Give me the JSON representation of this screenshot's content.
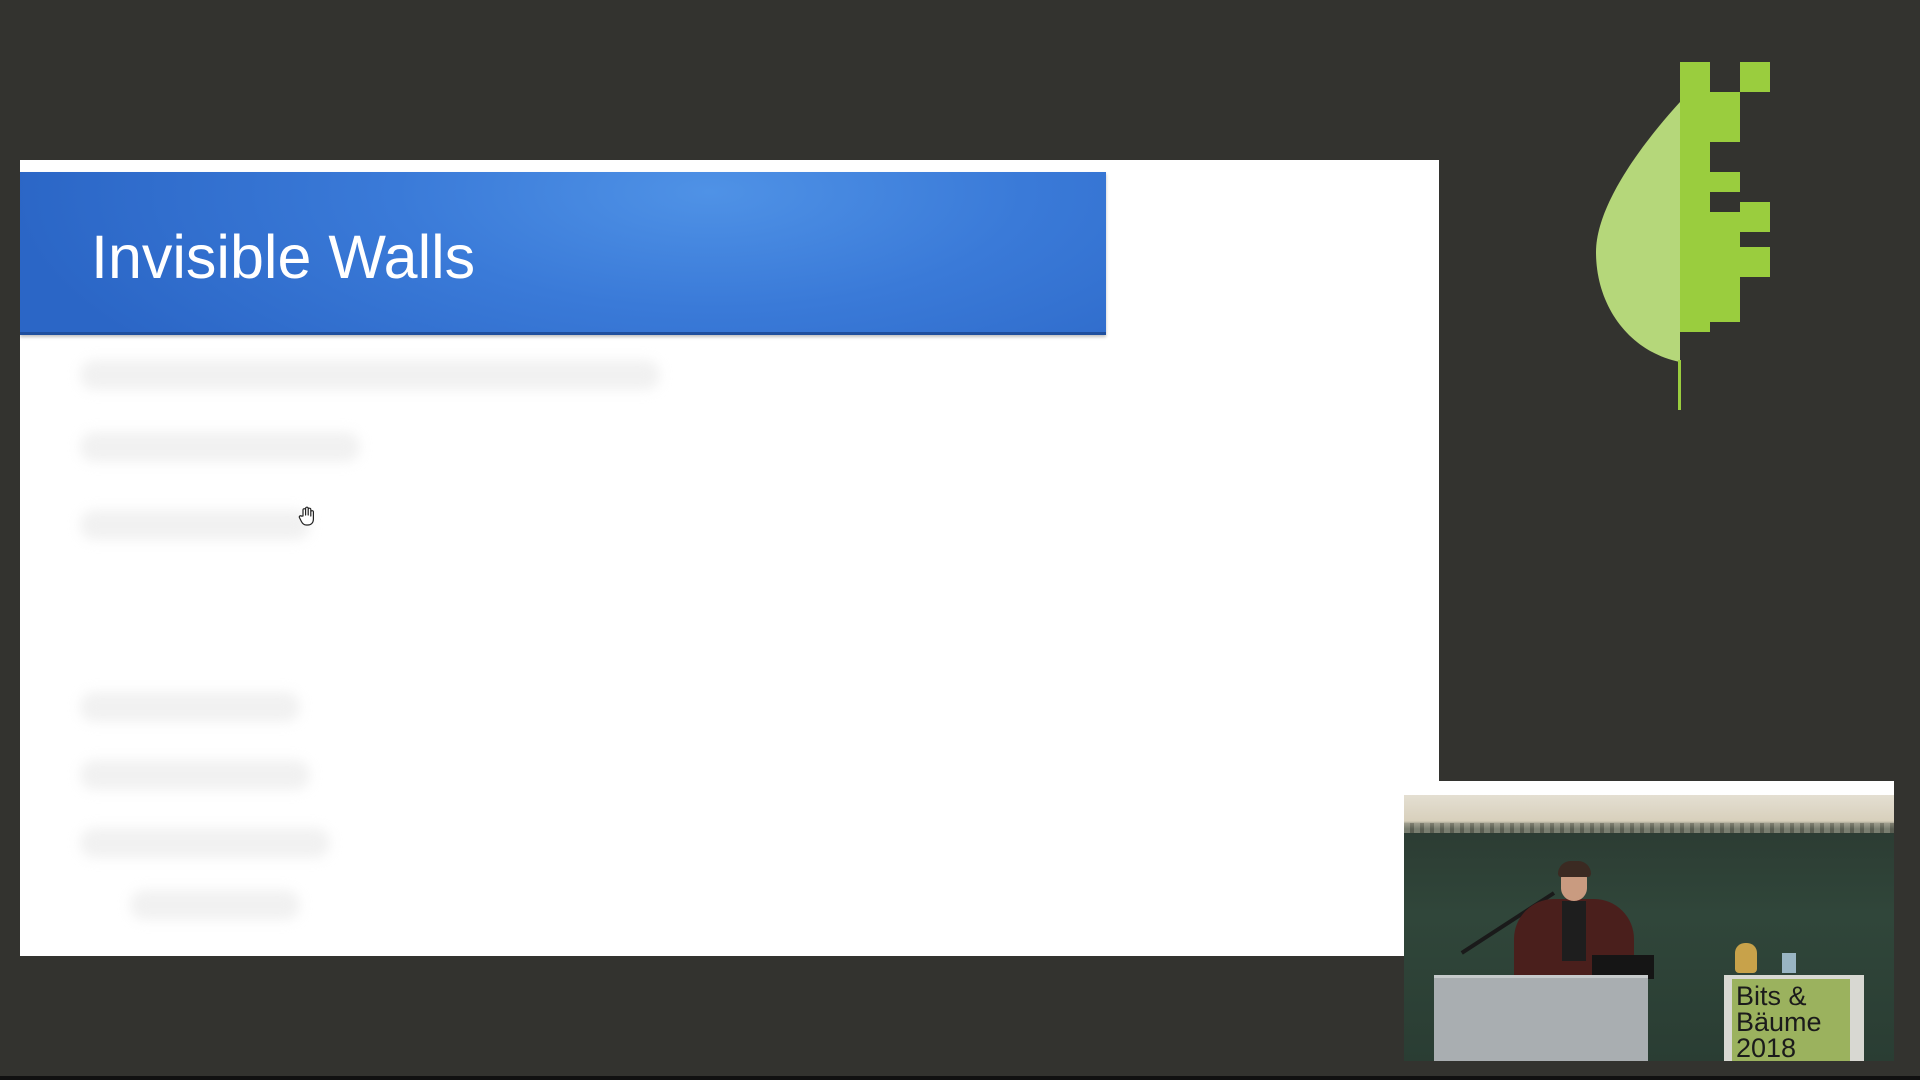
{
  "slide": {
    "title": "Invisible Walls"
  },
  "logo": {
    "icon": "bits-und-baeume-leaf-logo-icon",
    "colors": {
      "light_green": "#b5d77a",
      "bright_green": "#9acd3e"
    }
  },
  "camera": {
    "banner_text": "Bits &\nBäume\n2018"
  },
  "colors": {
    "background": "#33332f",
    "header_blue": "#2b66c6",
    "slide_bg": "#ffffff"
  }
}
